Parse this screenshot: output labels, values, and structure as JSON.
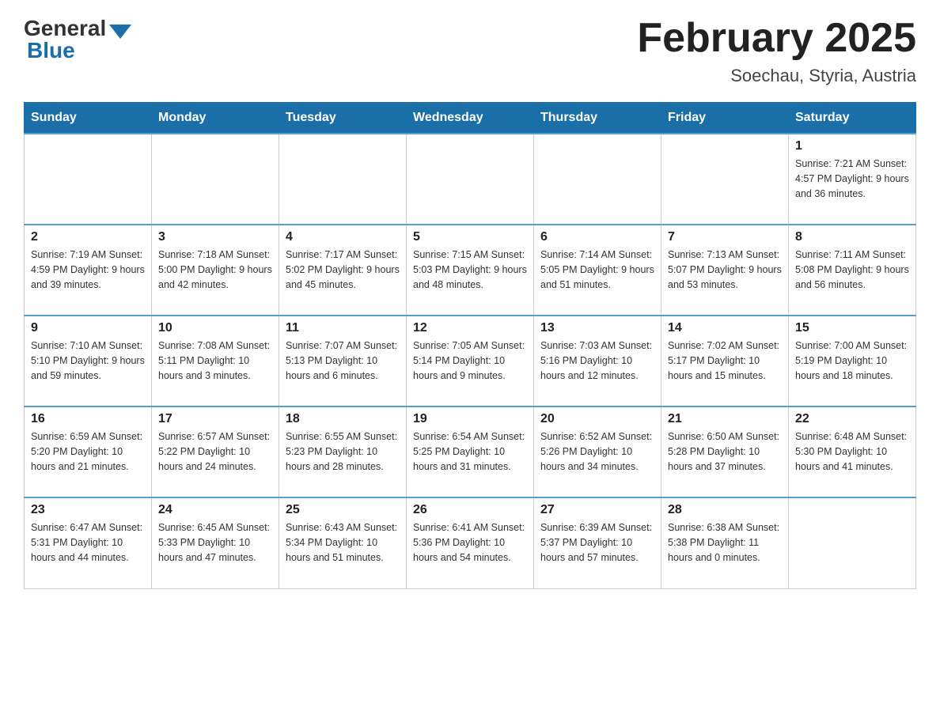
{
  "header": {
    "logo_general": "General",
    "logo_blue": "Blue",
    "title": "February 2025",
    "location": "Soechau, Styria, Austria"
  },
  "weekdays": [
    "Sunday",
    "Monday",
    "Tuesday",
    "Wednesday",
    "Thursday",
    "Friday",
    "Saturday"
  ],
  "weeks": [
    [
      {
        "day": "",
        "info": ""
      },
      {
        "day": "",
        "info": ""
      },
      {
        "day": "",
        "info": ""
      },
      {
        "day": "",
        "info": ""
      },
      {
        "day": "",
        "info": ""
      },
      {
        "day": "",
        "info": ""
      },
      {
        "day": "1",
        "info": "Sunrise: 7:21 AM\nSunset: 4:57 PM\nDaylight: 9 hours and 36 minutes."
      }
    ],
    [
      {
        "day": "2",
        "info": "Sunrise: 7:19 AM\nSunset: 4:59 PM\nDaylight: 9 hours and 39 minutes."
      },
      {
        "day": "3",
        "info": "Sunrise: 7:18 AM\nSunset: 5:00 PM\nDaylight: 9 hours and 42 minutes."
      },
      {
        "day": "4",
        "info": "Sunrise: 7:17 AM\nSunset: 5:02 PM\nDaylight: 9 hours and 45 minutes."
      },
      {
        "day": "5",
        "info": "Sunrise: 7:15 AM\nSunset: 5:03 PM\nDaylight: 9 hours and 48 minutes."
      },
      {
        "day": "6",
        "info": "Sunrise: 7:14 AM\nSunset: 5:05 PM\nDaylight: 9 hours and 51 minutes."
      },
      {
        "day": "7",
        "info": "Sunrise: 7:13 AM\nSunset: 5:07 PM\nDaylight: 9 hours and 53 minutes."
      },
      {
        "day": "8",
        "info": "Sunrise: 7:11 AM\nSunset: 5:08 PM\nDaylight: 9 hours and 56 minutes."
      }
    ],
    [
      {
        "day": "9",
        "info": "Sunrise: 7:10 AM\nSunset: 5:10 PM\nDaylight: 9 hours and 59 minutes."
      },
      {
        "day": "10",
        "info": "Sunrise: 7:08 AM\nSunset: 5:11 PM\nDaylight: 10 hours and 3 minutes."
      },
      {
        "day": "11",
        "info": "Sunrise: 7:07 AM\nSunset: 5:13 PM\nDaylight: 10 hours and 6 minutes."
      },
      {
        "day": "12",
        "info": "Sunrise: 7:05 AM\nSunset: 5:14 PM\nDaylight: 10 hours and 9 minutes."
      },
      {
        "day": "13",
        "info": "Sunrise: 7:03 AM\nSunset: 5:16 PM\nDaylight: 10 hours and 12 minutes."
      },
      {
        "day": "14",
        "info": "Sunrise: 7:02 AM\nSunset: 5:17 PM\nDaylight: 10 hours and 15 minutes."
      },
      {
        "day": "15",
        "info": "Sunrise: 7:00 AM\nSunset: 5:19 PM\nDaylight: 10 hours and 18 minutes."
      }
    ],
    [
      {
        "day": "16",
        "info": "Sunrise: 6:59 AM\nSunset: 5:20 PM\nDaylight: 10 hours and 21 minutes."
      },
      {
        "day": "17",
        "info": "Sunrise: 6:57 AM\nSunset: 5:22 PM\nDaylight: 10 hours and 24 minutes."
      },
      {
        "day": "18",
        "info": "Sunrise: 6:55 AM\nSunset: 5:23 PM\nDaylight: 10 hours and 28 minutes."
      },
      {
        "day": "19",
        "info": "Sunrise: 6:54 AM\nSunset: 5:25 PM\nDaylight: 10 hours and 31 minutes."
      },
      {
        "day": "20",
        "info": "Sunrise: 6:52 AM\nSunset: 5:26 PM\nDaylight: 10 hours and 34 minutes."
      },
      {
        "day": "21",
        "info": "Sunrise: 6:50 AM\nSunset: 5:28 PM\nDaylight: 10 hours and 37 minutes."
      },
      {
        "day": "22",
        "info": "Sunrise: 6:48 AM\nSunset: 5:30 PM\nDaylight: 10 hours and 41 minutes."
      }
    ],
    [
      {
        "day": "23",
        "info": "Sunrise: 6:47 AM\nSunset: 5:31 PM\nDaylight: 10 hours and 44 minutes."
      },
      {
        "day": "24",
        "info": "Sunrise: 6:45 AM\nSunset: 5:33 PM\nDaylight: 10 hours and 47 minutes."
      },
      {
        "day": "25",
        "info": "Sunrise: 6:43 AM\nSunset: 5:34 PM\nDaylight: 10 hours and 51 minutes."
      },
      {
        "day": "26",
        "info": "Sunrise: 6:41 AM\nSunset: 5:36 PM\nDaylight: 10 hours and 54 minutes."
      },
      {
        "day": "27",
        "info": "Sunrise: 6:39 AM\nSunset: 5:37 PM\nDaylight: 10 hours and 57 minutes."
      },
      {
        "day": "28",
        "info": "Sunrise: 6:38 AM\nSunset: 5:38 PM\nDaylight: 11 hours and 0 minutes."
      },
      {
        "day": "",
        "info": ""
      }
    ]
  ]
}
